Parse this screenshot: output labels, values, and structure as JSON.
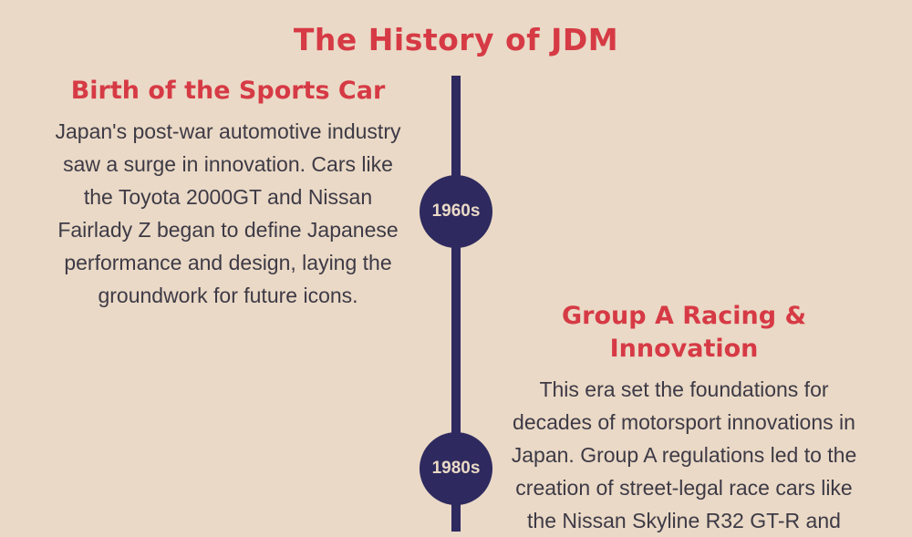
{
  "page": {
    "title": "The History of JDM"
  },
  "timeline": {
    "events": [
      {
        "era": "1960s",
        "title": "Birth of the Sports Car",
        "description": "Japan's post-war automotive industry saw a surge in innovation. Cars like the Toyota 2000GT and Nissan Fairlady Z began to define Japanese performance and design, laying the groundwork for future icons."
      },
      {
        "era": "1980s",
        "title": "Group A Racing & Innovation",
        "description": "This era set the foundations for decades of motorsport innovations in Japan. Group A regulations led to the creation of street-legal race cars like the Nissan Skyline R32 GT-R and"
      }
    ]
  },
  "colors": {
    "background": "#ead9c6",
    "accent": "#d63a45",
    "timeline": "#2e2a5f",
    "text": "#3d3a46"
  }
}
